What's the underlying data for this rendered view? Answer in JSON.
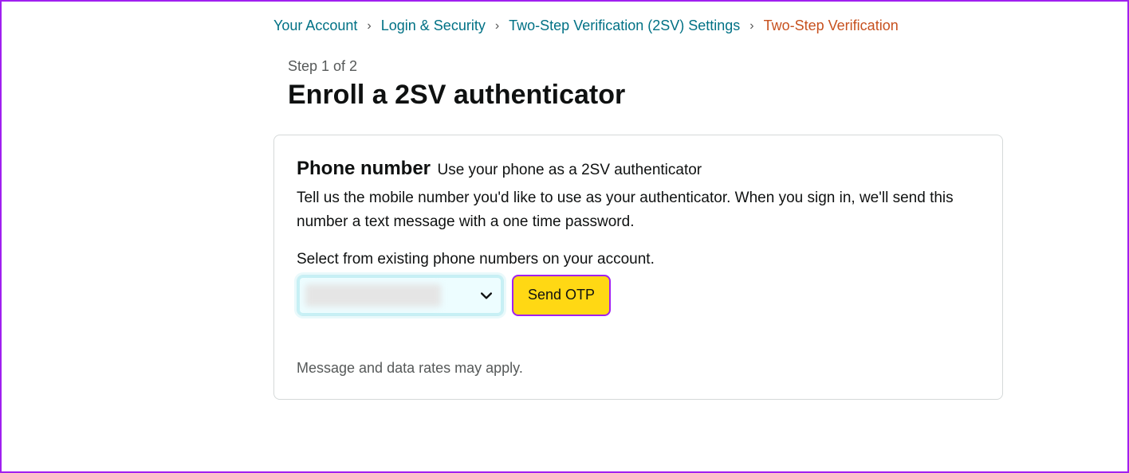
{
  "breadcrumb": {
    "items": [
      {
        "label": "Your Account"
      },
      {
        "label": "Login & Security"
      },
      {
        "label": "Two-Step Verification (2SV) Settings"
      }
    ],
    "current": "Two-Step Verification",
    "separator": "›"
  },
  "step_label": "Step 1 of 2",
  "page_title": "Enroll a 2SV authenticator",
  "section": {
    "title": "Phone number",
    "subtitle": "Use your phone as a 2SV authenticator",
    "description": "Tell us the mobile number you'd like to use as your authenticator. When you sign in, we'll send this number a text message with a one time password.",
    "select_label": "Select from existing phone numbers on your account.",
    "send_button": "Send OTP",
    "disclaimer": "Message and data rates may apply."
  }
}
